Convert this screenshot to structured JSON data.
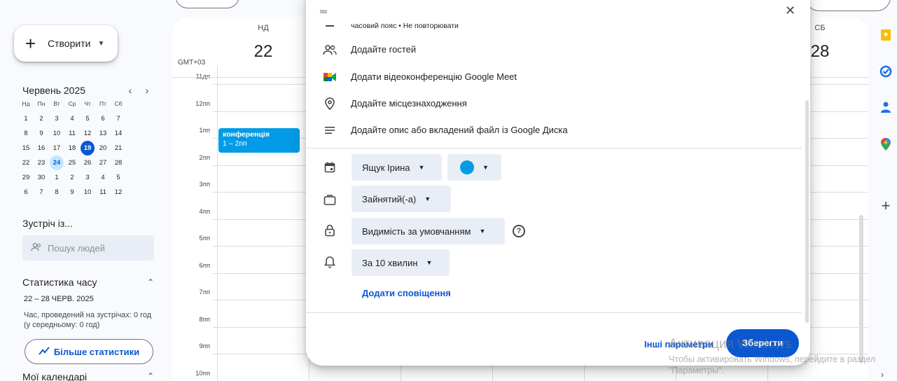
{
  "sidebar": {
    "create_label": "Створити",
    "mini_calendar": {
      "month": "Червень 2025",
      "weekdays": [
        "Нд",
        "Пн",
        "Вт",
        "Ср",
        "Чт",
        "Пт",
        "Сб"
      ],
      "weeks": [
        [
          "1",
          "2",
          "3",
          "4",
          "5",
          "6",
          "7"
        ],
        [
          "8",
          "9",
          "10",
          "11",
          "12",
          "13",
          "14"
        ],
        [
          "15",
          "16",
          "17",
          "18",
          "19",
          "20",
          "21"
        ],
        [
          "22",
          "23",
          "24",
          "25",
          "26",
          "27",
          "28"
        ],
        [
          "29",
          "30",
          "1",
          "2",
          "3",
          "4",
          "5"
        ],
        [
          "6",
          "7",
          "8",
          "9",
          "10",
          "11",
          "12"
        ]
      ],
      "today": "19",
      "selected": "24"
    },
    "meet_with": "Зустріч із...",
    "people_search_placeholder": "Пошук людей",
    "time_stats": {
      "title": "Статистика часу",
      "range": "22 – 28 ЧЕРВ. 2025",
      "description": "Час, проведений на зустрічах: 0 год (у середньому: 0 год)",
      "more_button": "Більше статистики"
    },
    "my_calendars": "Мої календарі"
  },
  "calendar": {
    "timezone": "GMT+03",
    "days": [
      {
        "dow": "НД",
        "num": "22"
      },
      {
        "dow": "СБ",
        "num": "28"
      }
    ],
    "hours": [
      "11дп",
      "12пп",
      "1пп",
      "2пп",
      "3пп",
      "4пп",
      "5пп",
      "6пп",
      "7пп",
      "8пп",
      "9пп",
      "10пп"
    ],
    "event": {
      "title": "конференція",
      "time": "1 – 2пп",
      "color": "#039be5"
    }
  },
  "dialog": {
    "timezone_repeat": "часовий пояс • Не повторювати",
    "add_guests": "Додайте гостей",
    "add_meet": "Додати відеоконференцію Google Meet",
    "add_location": "Додайте місцезнаходження",
    "add_description": "Додайте опис або вкладений файл із Google Диска",
    "calendar_owner": "Ящук Ірина",
    "event_color": "#039be5",
    "availability": "Зайнятий(-а)",
    "visibility": "Видимість за умовчанням",
    "notification": "За 10 хвилин",
    "add_notification": "Додати сповіщення",
    "more_options": "Інші параметри",
    "save": "Зберегти"
  },
  "watermark": {
    "title": "Активация Windows",
    "text": "Чтобы активировать Windows, перейдите в раздел \"Параметры\"."
  },
  "colors": {
    "primary": "#0b57d0",
    "event": "#039be5",
    "selected_bg": "#c2e7ff"
  }
}
